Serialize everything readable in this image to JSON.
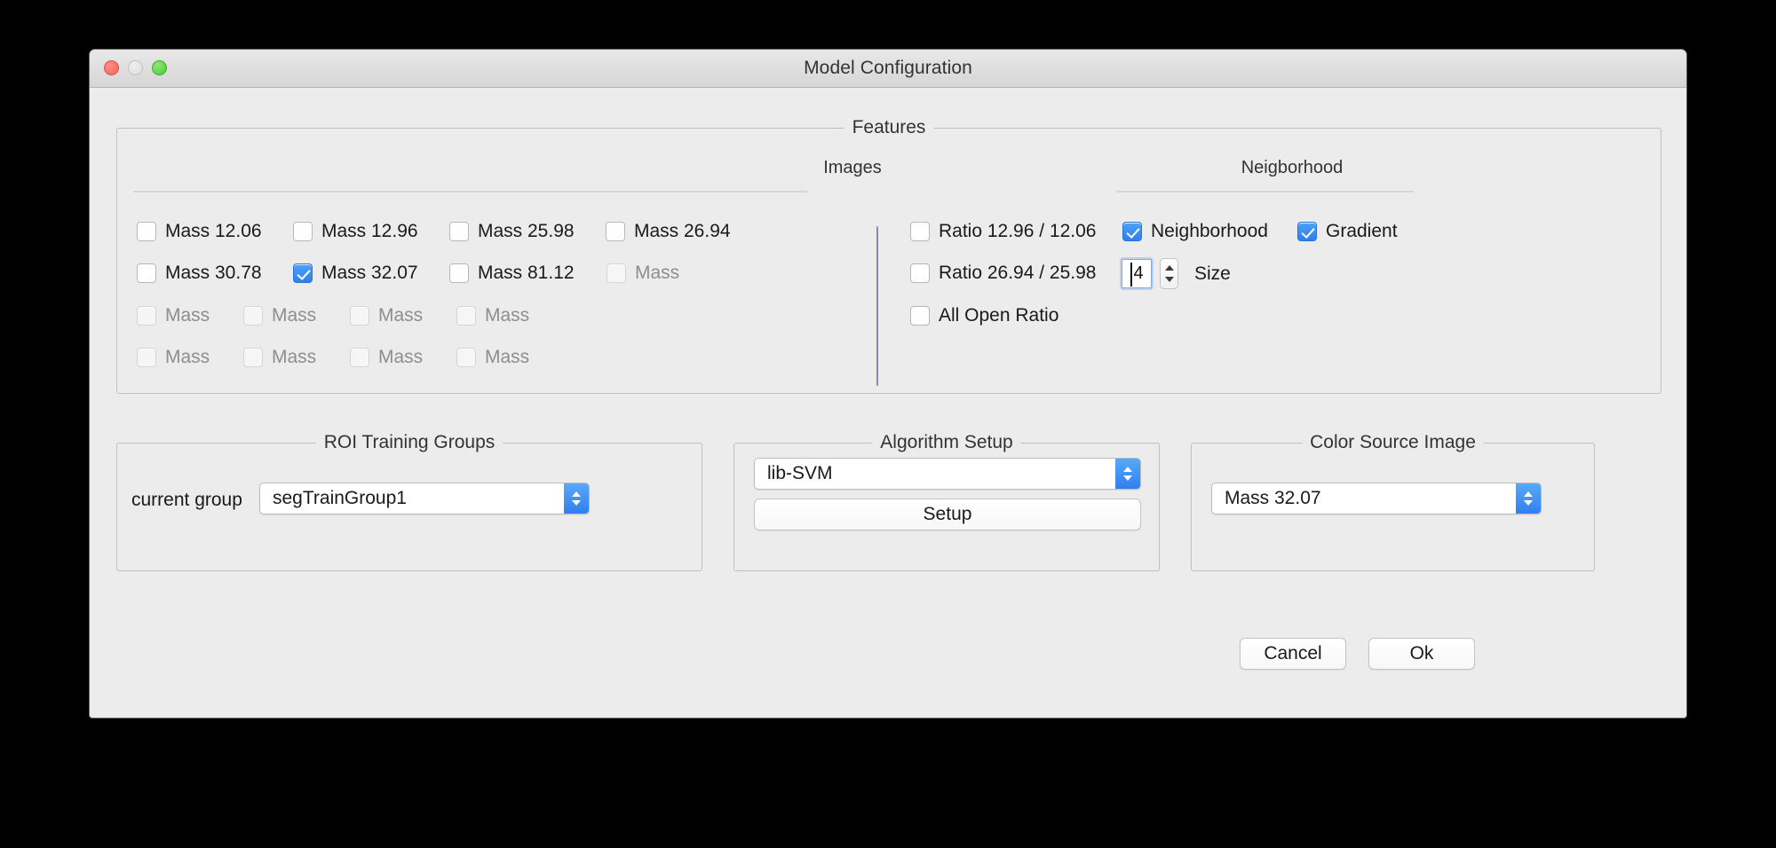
{
  "window": {
    "title": "Model Configuration",
    "controls": {
      "close": "close-button",
      "minimize": "minimize-button",
      "zoom": "zoom-button"
    }
  },
  "features": {
    "group_title": "Features",
    "images_header": "Images",
    "neighborhood_header": "Neigborhood",
    "image_checkboxes": [
      {
        "label": "Mass 12.06",
        "checked": false,
        "disabled": false
      },
      {
        "label": "Mass 12.96",
        "checked": false,
        "disabled": false
      },
      {
        "label": "Mass 25.98",
        "checked": false,
        "disabled": false
      },
      {
        "label": "Mass 26.94",
        "checked": false,
        "disabled": false
      },
      {
        "label": "Mass 30.78",
        "checked": false,
        "disabled": false
      },
      {
        "label": "Mass 32.07",
        "checked": true,
        "disabled": false
      },
      {
        "label": "Mass 81.12",
        "checked": false,
        "disabled": false
      },
      {
        "label": "Mass",
        "checked": false,
        "disabled": true
      },
      {
        "label": "Mass",
        "checked": false,
        "disabled": true
      },
      {
        "label": "Mass",
        "checked": false,
        "disabled": true
      },
      {
        "label": "Mass",
        "checked": false,
        "disabled": true
      },
      {
        "label": "Mass",
        "checked": false,
        "disabled": true
      },
      {
        "label": "Mass",
        "checked": false,
        "disabled": true
      },
      {
        "label": "Mass",
        "checked": false,
        "disabled": true
      },
      {
        "label": "Mass",
        "checked": false,
        "disabled": true
      },
      {
        "label": "Mass",
        "checked": false,
        "disabled": true
      }
    ],
    "ratio_checkboxes": [
      {
        "label": "Ratio 12.96 / 12.06",
        "checked": false
      },
      {
        "label": "Ratio 26.94 / 25.98",
        "checked": false
      },
      {
        "label": "All Open Ratio",
        "checked": false
      }
    ],
    "neighborhood_checkbox": {
      "label": "Neighborhood",
      "checked": true
    },
    "gradient_checkbox": {
      "label": "Gradient",
      "checked": true
    },
    "size_field": {
      "value": "4",
      "label": "Size"
    }
  },
  "roi_training_groups": {
    "group_title": "ROI Training Groups",
    "current_group_label": "current group",
    "current_group_value": "segTrainGroup1"
  },
  "algorithm_setup": {
    "group_title": "Algorithm Setup",
    "algorithm_value": "lib-SVM",
    "setup_button": "Setup"
  },
  "color_source_image": {
    "group_title": "Color Source Image",
    "value": "Mass 32.07"
  },
  "actions": {
    "cancel": "Cancel",
    "ok": "Ok"
  },
  "colors": {
    "accent": "#2f7ff0",
    "window_bg": "#ececec",
    "divider": "#7d8fc0",
    "close_light": "#f0665b",
    "minimize_light": "#dcdcdc",
    "zoom_light": "#4dc63c"
  }
}
